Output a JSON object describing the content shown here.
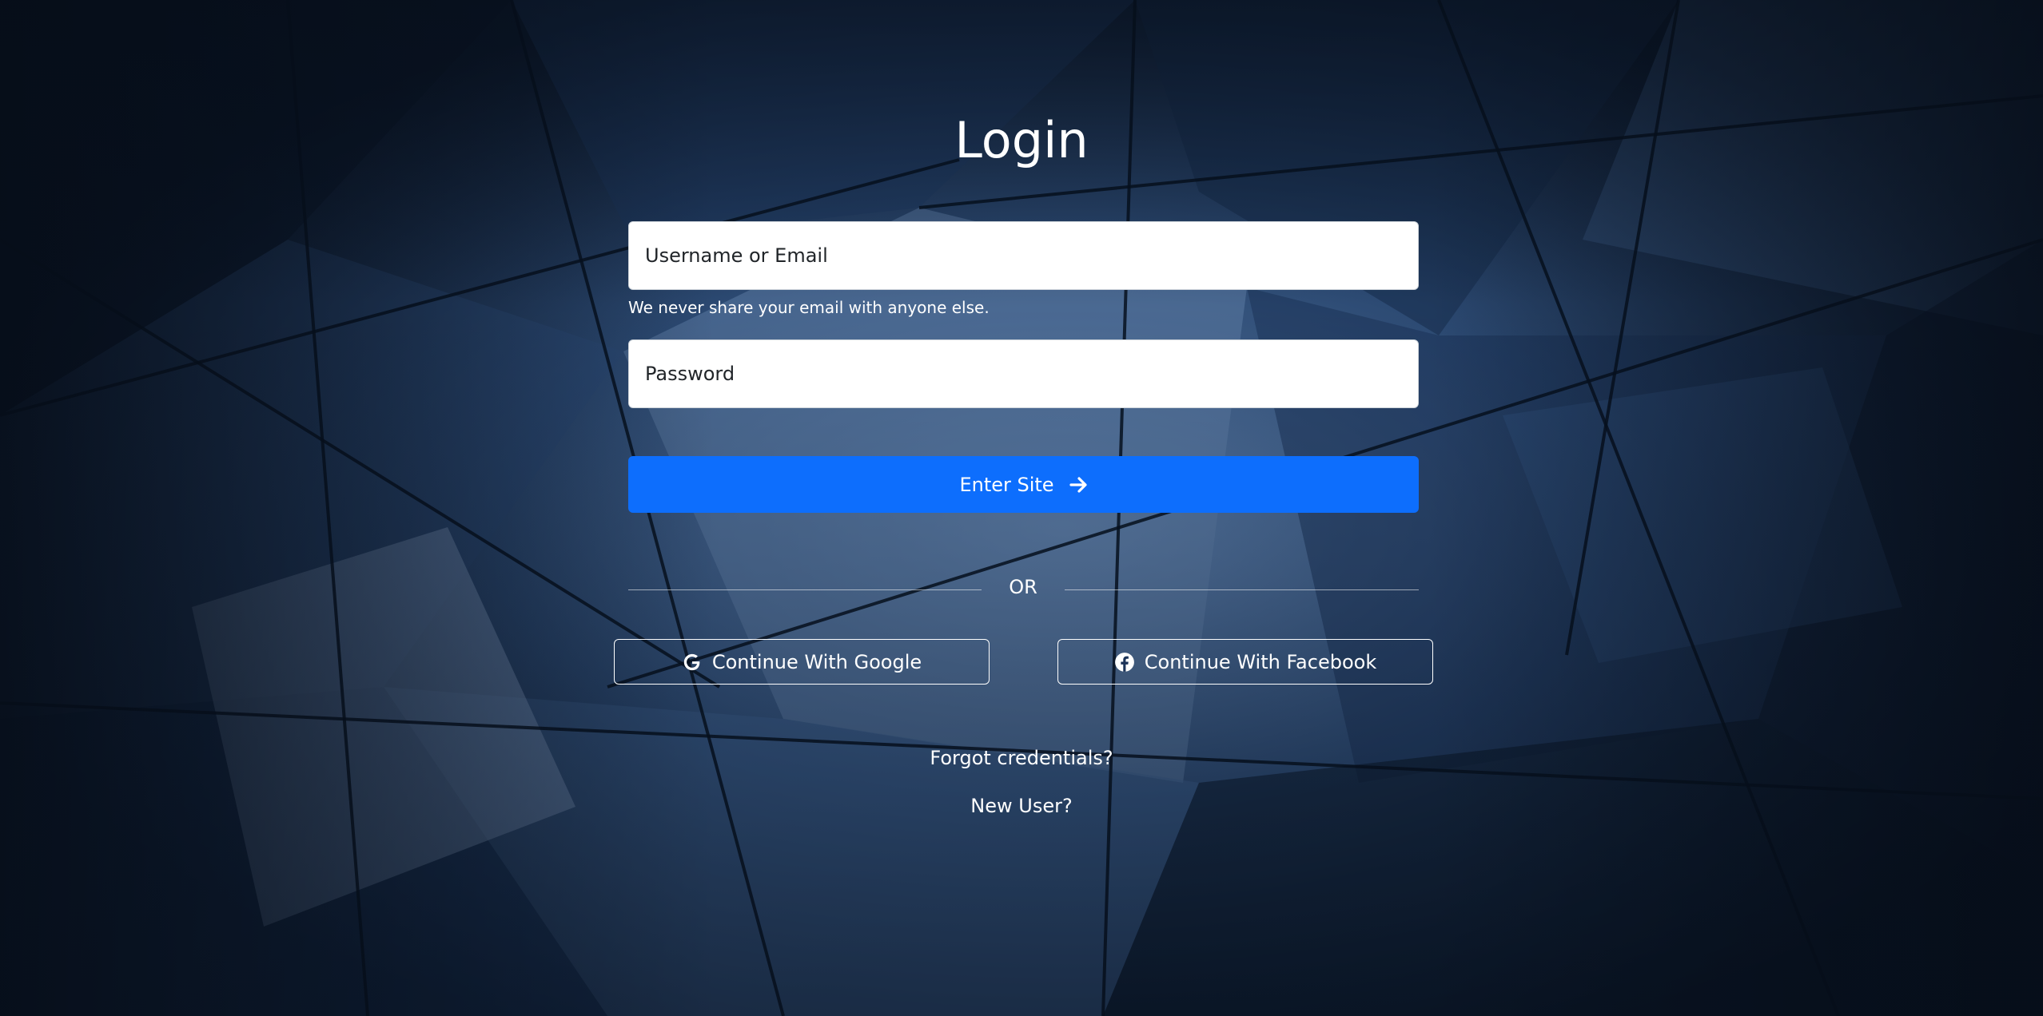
{
  "title": "Login",
  "form": {
    "username_placeholder": "Username or Email",
    "email_help": "We never share your email with anyone else.",
    "password_placeholder": "Password",
    "submit_label": "Enter Site"
  },
  "divider": {
    "label": "OR"
  },
  "social": {
    "google_label": "Continue With Google",
    "facebook_label": "Continue With Facebook"
  },
  "links": {
    "forgot": "Forgot credentials?",
    "new_user": "New User?"
  },
  "icons": {
    "submit": "arrow-right-icon",
    "google": "google-icon",
    "facebook": "facebook-icon"
  },
  "colors": {
    "primary": "#0d6efd",
    "text_light": "#ffffff",
    "background": "#14233d"
  }
}
